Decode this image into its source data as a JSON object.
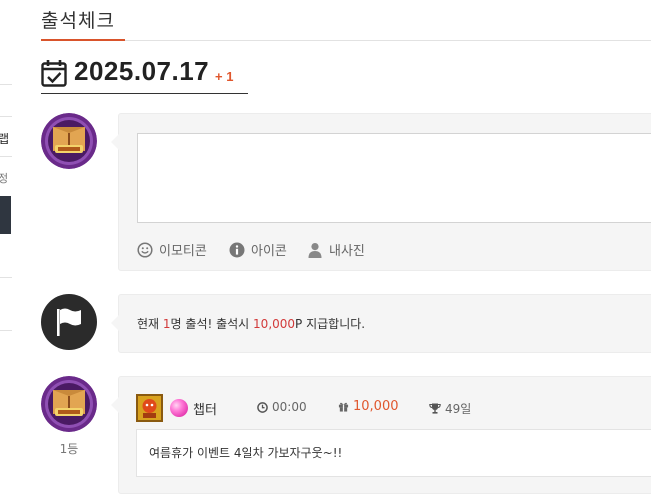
{
  "page": {
    "title": "출석체크"
  },
  "sidebar_fragment": {
    "item_1": "랩",
    "item_2": "정"
  },
  "date_header": {
    "date": "2025.07.17",
    "count_badge": "+ 1"
  },
  "comment_form": {
    "textarea_value": "",
    "tools": [
      {
        "icon": "smile-icon",
        "label": "이모티콘"
      },
      {
        "icon": "info-icon",
        "label": "아이콘"
      },
      {
        "icon": "user-icon",
        "label": "내사진"
      }
    ]
  },
  "notice": {
    "prefix": "현재 ",
    "count": "1",
    "middle": "명 출석! 출석시 ",
    "points": "10,000",
    "suffix": "P 지급합니다."
  },
  "entries": [
    {
      "rank": "1등",
      "nickname": "챕터",
      "time": "00:00",
      "points": "10,000",
      "days": "49일",
      "message": "여름휴가 이벤트 4일차 가보자구웃~!!"
    }
  ],
  "colors": {
    "accent": "#d9542b",
    "point_orange": "#e0572d",
    "red_text": "#d23a3a",
    "box_bg": "#f5f5f5"
  }
}
